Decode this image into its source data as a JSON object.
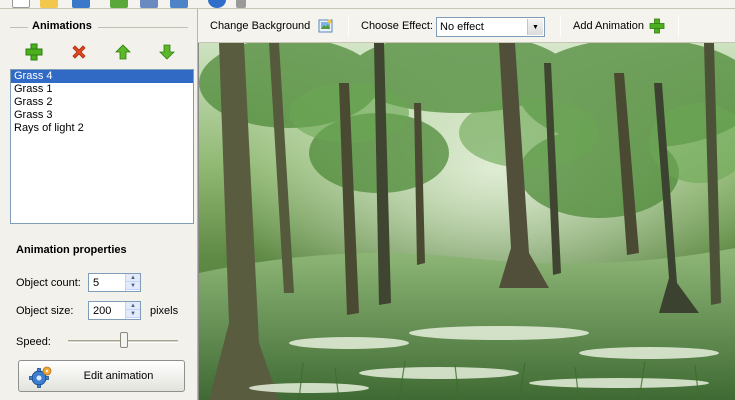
{
  "left_panel": {
    "animations_title": "Animations",
    "list_items": [
      "Grass 4",
      "Grass 1",
      "Grass 2",
      "Grass 3",
      "Rays of light 2"
    ],
    "selected_index": 0,
    "properties_title": "Animation properties",
    "object_count_label": "Object count:",
    "object_count_value": "5",
    "object_size_label": "Object size:",
    "object_size_value": "200",
    "object_size_unit": "pixels",
    "speed_label": "Speed:",
    "edit_button_label": "Edit animation"
  },
  "toolbar": {
    "change_background_label": "Change Background",
    "choose_effect_label": "Choose Effect:",
    "effect_value": "No effect",
    "add_animation_label": "Add Animation"
  },
  "colors": {
    "selection": "#316ac5",
    "add_green": "#4caf1e",
    "delete_red": "#e0481e",
    "arrow_green": "#5cb82a"
  }
}
